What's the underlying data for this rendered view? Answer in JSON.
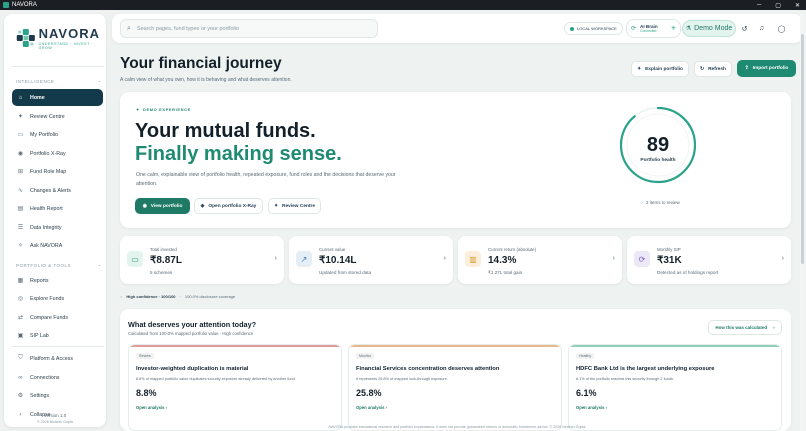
{
  "window": {
    "title": "NAVORA"
  },
  "brand": {
    "name": "NAVORA",
    "tagline": "UNDERSTAND · INVEST · GROW"
  },
  "sidebar": {
    "section_intelligence": "INTELLIGENCE",
    "section_portfolio": "PORTFOLIO & TOOLS",
    "intelligence_items": [
      {
        "label": "Home",
        "icon": "home-icon",
        "active": true
      },
      {
        "label": "Review Centre",
        "icon": "sparkle-icon"
      },
      {
        "label": "My Portfolio",
        "icon": "folder-icon"
      },
      {
        "label": "Portfolio X-Ray",
        "icon": "eye-icon"
      },
      {
        "label": "Fund Role Map",
        "icon": "map-icon"
      },
      {
        "label": "Changes & Alerts",
        "icon": "pulse-icon"
      },
      {
        "label": "Health Report",
        "icon": "document-icon"
      },
      {
        "label": "Data Integrity",
        "icon": "database-icon"
      },
      {
        "label": "Ask NAVORA",
        "icon": "chat-icon"
      }
    ],
    "tools_items": [
      {
        "label": "Reports",
        "icon": "report-icon"
      },
      {
        "label": "Explore Funds",
        "icon": "compass-icon"
      },
      {
        "label": "Compare Funds",
        "icon": "compare-icon"
      },
      {
        "label": "SIP Lab",
        "icon": "calendar-icon"
      }
    ],
    "footer_items": [
      {
        "label": "Platform & Access",
        "icon": "shield-icon"
      },
      {
        "label": "Connections",
        "icon": "link-icon"
      },
      {
        "label": "Settings",
        "icon": "gear-icon"
      },
      {
        "label": "Collapse",
        "icon": "chevron-left-icon"
      }
    ],
    "version": "Version 1.0",
    "copyright": "© 2026 Nirdesh Gupta"
  },
  "topbar": {
    "search_placeholder": "Search pages, fund types or your portfolio",
    "local_workspace": "LOCAL WORKSPACE",
    "brain_title": "AI Brain",
    "brain_status": "Connected",
    "demo_mode": "Demo Mode"
  },
  "header": {
    "title": "Your financial journey",
    "subtitle": "A calm view of what you own, how it is behaving and what deserves attention.",
    "explain_label": "Explain portfolio",
    "refresh_label": "Refresh",
    "import_label": "Import portfolio"
  },
  "hero": {
    "badge": "DEMO EXPERIENCE",
    "title_line1": "Your mutual funds.",
    "title_line2": "Finally making sense.",
    "description": "One calm, explainable view of portfolio health, repeated exposure, fund roles and the decisions that deserve your attention.",
    "btn_view": "View portfolio",
    "btn_xray": "Open portfolio X-Ray",
    "btn_review": "Review Centre",
    "health_score": "89",
    "health_score_value": 89,
    "health_label": "Portfolio health",
    "review_items": "2 items to review"
  },
  "stats": [
    {
      "label": "Total invested",
      "value": "₹8.87L",
      "note": "5 schemes",
      "icon": "wallet-icon",
      "bg": "#e3f3ee",
      "fg": "#1f8a72"
    },
    {
      "label": "Current value",
      "value": "₹10.14L",
      "note": "Updated from stored data",
      "icon": "trend-up-icon",
      "bg": "#e4eef7",
      "fg": "#3a78b8"
    },
    {
      "label": "Current return (absolute)",
      "value": "14.3%",
      "note": "₹1.27L total gain",
      "icon": "bar-chart-icon",
      "bg": "#fbefdc",
      "fg": "#d69a2e"
    },
    {
      "label": "Monthly SIP",
      "value": "₹31K",
      "note": "Detected as of holdings report",
      "icon": "repeat-icon",
      "bg": "#ece8f7",
      "fg": "#7a62c2"
    }
  ],
  "confidence": {
    "label": "High confidence · 100/100",
    "coverage": "100.0% disclosure coverage"
  },
  "attention": {
    "title": "What deserves your attention today?",
    "subtitle": "Calculated from 100.0% mapped portfolio value · High confidence",
    "how_label": "How this was calculated",
    "insights": [
      {
        "tag": "Review",
        "title": "Investor-weighted duplication is material",
        "desc": "8.8% of mapped portfolio value duplicates security exposure already delivered by another fund.",
        "value": "8.8%",
        "action": "Open analysis",
        "accent": "#e39a9a"
      },
      {
        "tag": "Monitor",
        "title": "Financial Services concentration deserves attention",
        "desc": "It represents 25.8% of mapped look-through exposure.",
        "value": "25.8%",
        "action": "Open analysis",
        "accent": "#e7b98a"
      },
      {
        "tag": "Healthy",
        "title": "HDFC Bank Ltd is the largest underlying exposure",
        "desc": "6.1% of the portfolio reaches this security through 2 funds.",
        "value": "6.1%",
        "action": "Open analysis",
        "accent": "#8fd0bd"
      }
    ]
  },
  "footer": "NAVORA provides educational research and portfolio explanations. It does not provide guaranteed returns or automatic investment advice. © 2026 Nirdesh Gupta"
}
